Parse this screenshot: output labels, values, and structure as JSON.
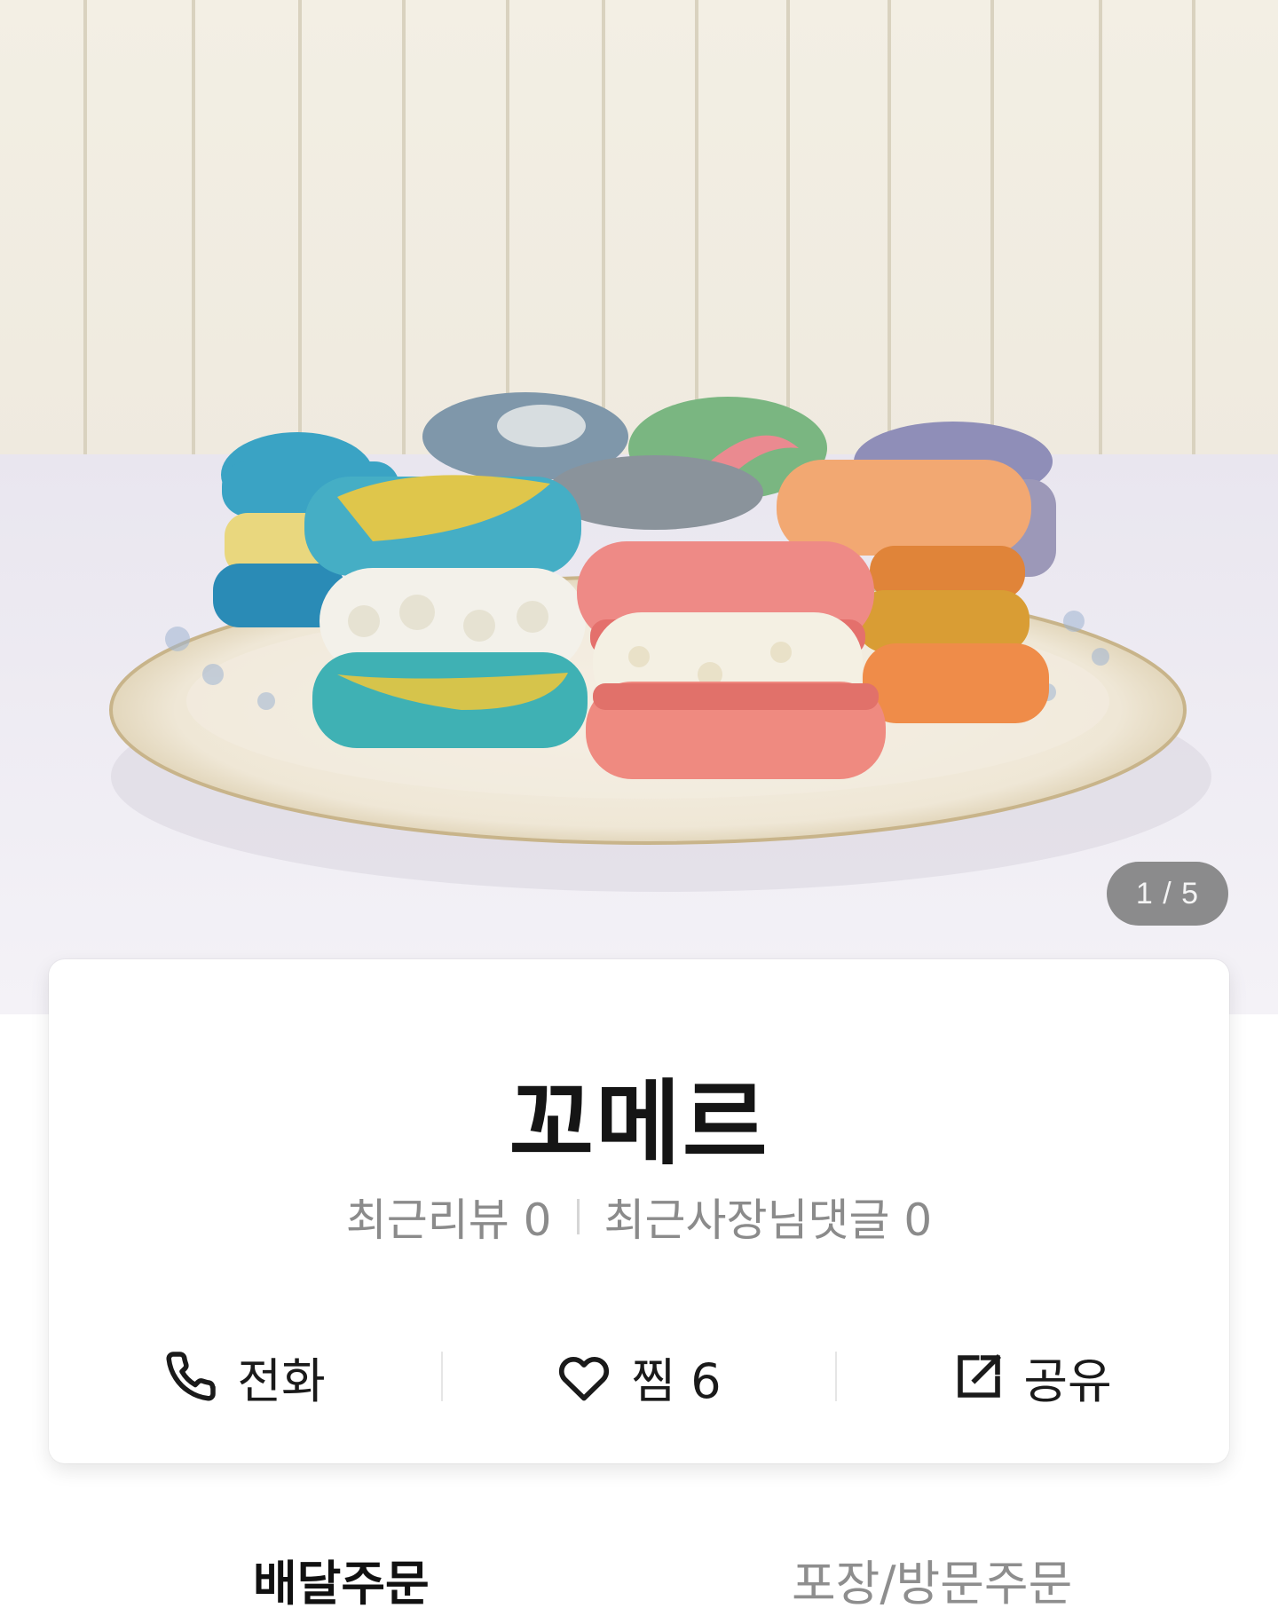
{
  "hero": {
    "image_description_icon": "macaron-photo",
    "counter": "1 / 5"
  },
  "store": {
    "name": "꼬메르",
    "stats": {
      "reviews": "최근리뷰 0",
      "owner_replies": "최근사장님댓글 0"
    },
    "actions": {
      "call": {
        "label": "전화",
        "icon": "phone-icon"
      },
      "favorite": {
        "label": "찜 6",
        "icon": "heart-icon"
      },
      "share": {
        "label": "공유",
        "icon": "share-icon"
      }
    }
  },
  "tabs": {
    "delivery": "배달주문",
    "pickup": "포장/방문주문"
  }
}
